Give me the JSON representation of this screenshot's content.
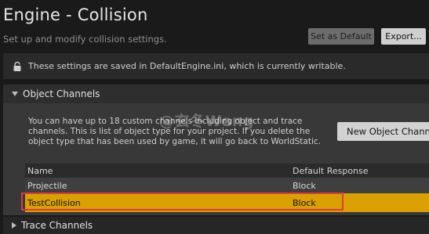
{
  "header": {
    "title": "Engine - Collision",
    "subtitle": "Set up and modify collision settings.",
    "set_default_label": "Set as Default",
    "export_label": "Export..."
  },
  "notice": {
    "icon": "lock-icon",
    "text": "These settings are saved in DefaultEngine.ini, which is currently writable."
  },
  "object_channels": {
    "label": "Object Channels",
    "description": "You can have up to 18 custom channels including object and trace channels. This is list of object type for your project. If you delete the object type that has been used by game, it will go back to WorldStatic.",
    "new_button_label": "New Object Channel...",
    "table": {
      "columns": [
        "Name",
        "Default Response"
      ],
      "rows": [
        {
          "name": "Projectile",
          "response": "Block"
        },
        {
          "name": "TestCollision",
          "response": "Block",
          "selected": true
        }
      ]
    }
  },
  "trace_channels": {
    "label": "Trace Channels"
  },
  "watermark": "@玄冬Wong",
  "colors": {
    "background": "#1a1a1a",
    "selected_row": "#d9a000",
    "highlight_border": "#e03a3a"
  }
}
